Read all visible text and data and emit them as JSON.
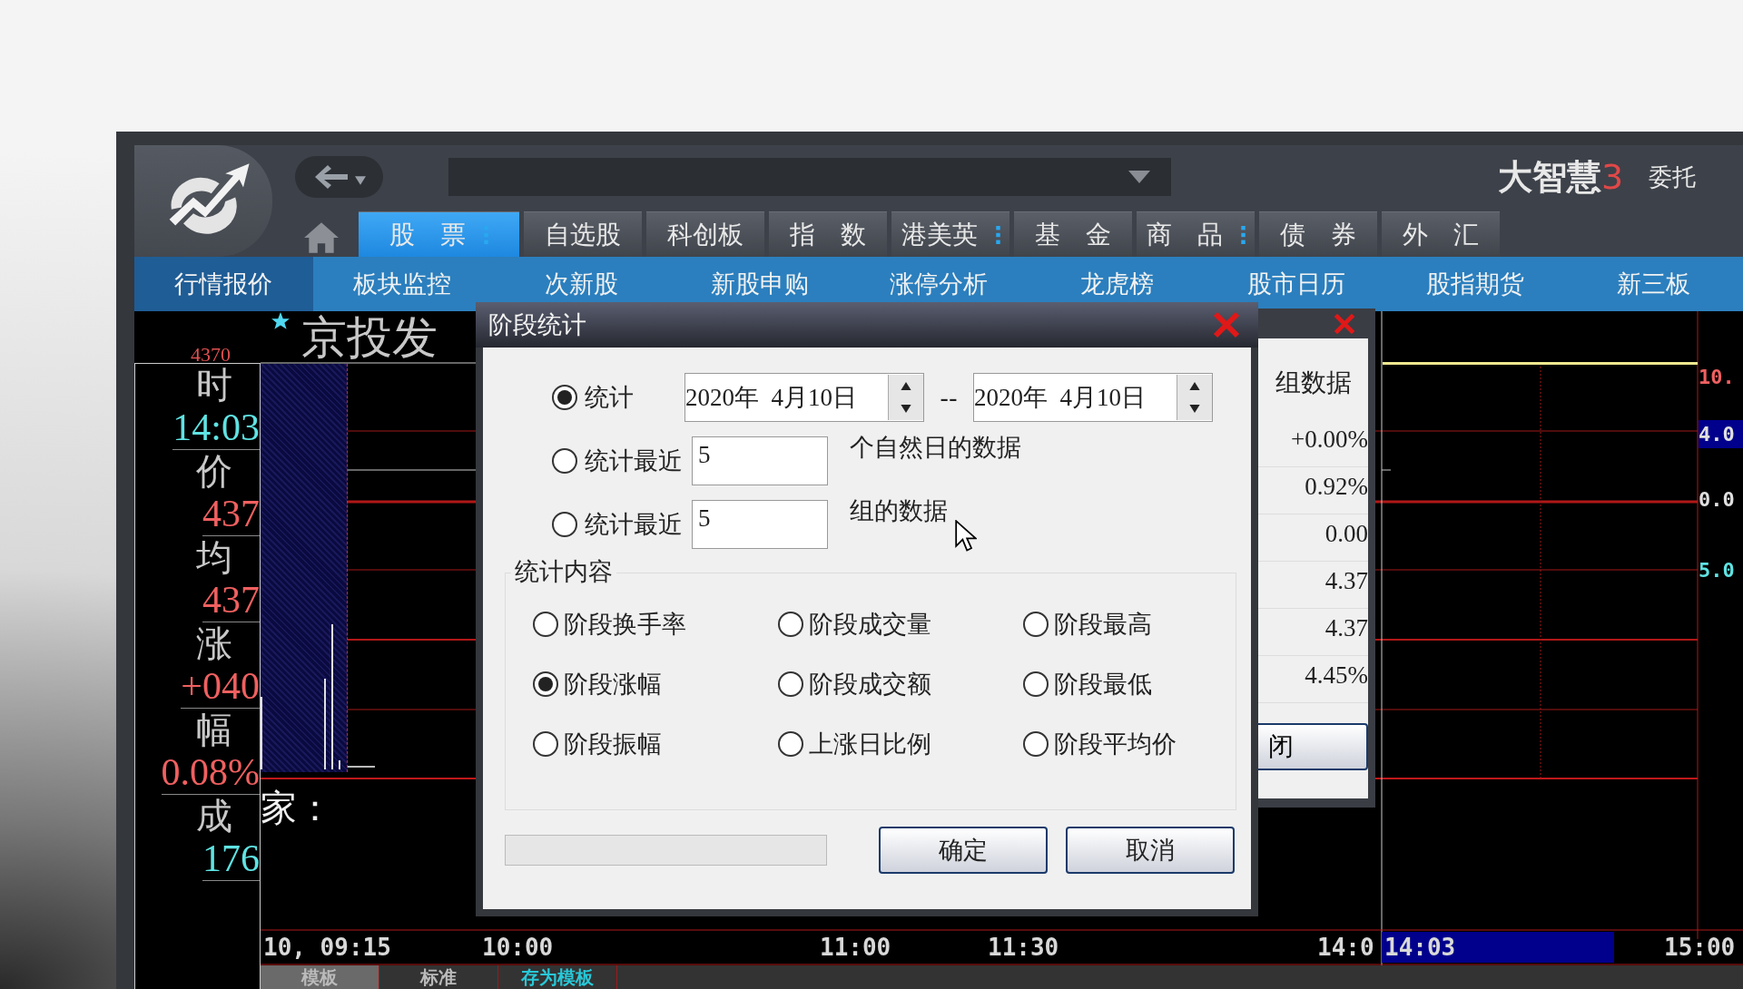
{
  "toolbar": {
    "brand": {
      "name": "大智慧",
      "number": "3"
    },
    "trade_link": "委托"
  },
  "nav_tabs": [
    {
      "label": "股　票",
      "selected": true,
      "menu": true
    },
    {
      "label": "自选股",
      "selected": false,
      "menu": false
    },
    {
      "label": "科创板",
      "selected": false,
      "menu": false
    },
    {
      "label": "指　数",
      "selected": false,
      "menu": false
    },
    {
      "label": "港美英",
      "selected": false,
      "menu": true
    },
    {
      "label": "基　金",
      "selected": false,
      "menu": false
    },
    {
      "label": "商　品",
      "selected": false,
      "menu": true
    },
    {
      "label": "债　券",
      "selected": false,
      "menu": false
    },
    {
      "label": "外　汇",
      "selected": false,
      "menu": false
    }
  ],
  "sub_nav": [
    {
      "label": "行情报价",
      "selected": true
    },
    {
      "label": "板块监控",
      "selected": false
    },
    {
      "label": "次新股",
      "selected": false
    },
    {
      "label": "新股申购",
      "selected": false
    },
    {
      "label": "涨停分析",
      "selected": false
    },
    {
      "label": "龙虎榜",
      "selected": false
    },
    {
      "label": "股市日历",
      "selected": false
    },
    {
      "label": "股指期货",
      "selected": false
    },
    {
      "label": "新三板",
      "selected": false
    }
  ],
  "chart": {
    "stock_name": "京投发",
    "top_price": "4370",
    "note": "家：",
    "info_panel": [
      {
        "label": "时",
        "value": "14:03",
        "color": "#5fe3e3"
      },
      {
        "label": "价",
        "value": "437",
        "color": "#f06060"
      },
      {
        "label": "均",
        "value": "437",
        "color": "#f06060"
      },
      {
        "label": "涨",
        "value": "+040",
        "color": "#f06060"
      },
      {
        "label": "幅",
        "value": "0.08%",
        "color": "#f06060"
      },
      {
        "label": "成",
        "value": "176",
        "color": "#5fe3e3"
      }
    ],
    "time_axis": [
      {
        "text": "10, 09:15",
        "selected": false
      },
      {
        "text": "10:00",
        "selected": false
      },
      {
        "text": "11:00",
        "selected": false
      },
      {
        "text": "11:30",
        "selected": false
      },
      {
        "text": "14:0",
        "selected": false
      },
      {
        "text": "14:03",
        "selected": true
      },
      {
        "text": "15:00",
        "selected": false
      }
    ],
    "right_axis": [
      {
        "text": "10.",
        "color": "#f06060",
        "selected": false
      },
      {
        "text": "4.0",
        "color": "#e0e0e0",
        "selected": true
      },
      {
        "text": "0.0",
        "color": "#e0e0e0",
        "selected": false
      },
      {
        "text": "5.0",
        "color": "#5fe3e3",
        "selected": false
      }
    ],
    "bottom_tabs": [
      {
        "label": "模板",
        "selected": true,
        "color": "#bbbbbb"
      },
      {
        "label": "标准",
        "selected": false,
        "color": "#bbbbbb"
      },
      {
        "label": "存为模板",
        "selected": false,
        "color": "#28c8d8"
      }
    ]
  },
  "back_dialog": {
    "heading": "组数据",
    "values": [
      "+0.00%",
      "0.92%",
      "0.00",
      "4.37",
      "4.37",
      "4.45%"
    ],
    "button": "闭"
  },
  "dialog": {
    "title": "阶段统计",
    "range_options": [
      {
        "kind": "dates",
        "label": "统计",
        "selected": true,
        "from": "2020年  4月10日",
        "separator": "--",
        "to": "2020年  4月10日"
      },
      {
        "kind": "count",
        "label": "统计最近",
        "selected": false,
        "value": "5",
        "suffix": "个自然日的数据"
      },
      {
        "kind": "count",
        "label": "统计最近",
        "selected": false,
        "value": "5",
        "suffix": "组的数据"
      }
    ],
    "group_title": "统计内容",
    "stat_options": [
      {
        "label": "阶段换手率",
        "selected": false
      },
      {
        "label": "阶段成交量",
        "selected": false
      },
      {
        "label": "阶段最高",
        "selected": false
      },
      {
        "label": "阶段涨幅",
        "selected": true
      },
      {
        "label": "阶段成交额",
        "selected": false
      },
      {
        "label": "阶段最低",
        "selected": false
      },
      {
        "label": "阶段振幅",
        "selected": false
      },
      {
        "label": "上涨日比例",
        "selected": false
      },
      {
        "label": "阶段平均价",
        "selected": false
      }
    ],
    "progress": {
      "level": 0
    },
    "buttons": [
      "确定",
      "取消"
    ]
  }
}
